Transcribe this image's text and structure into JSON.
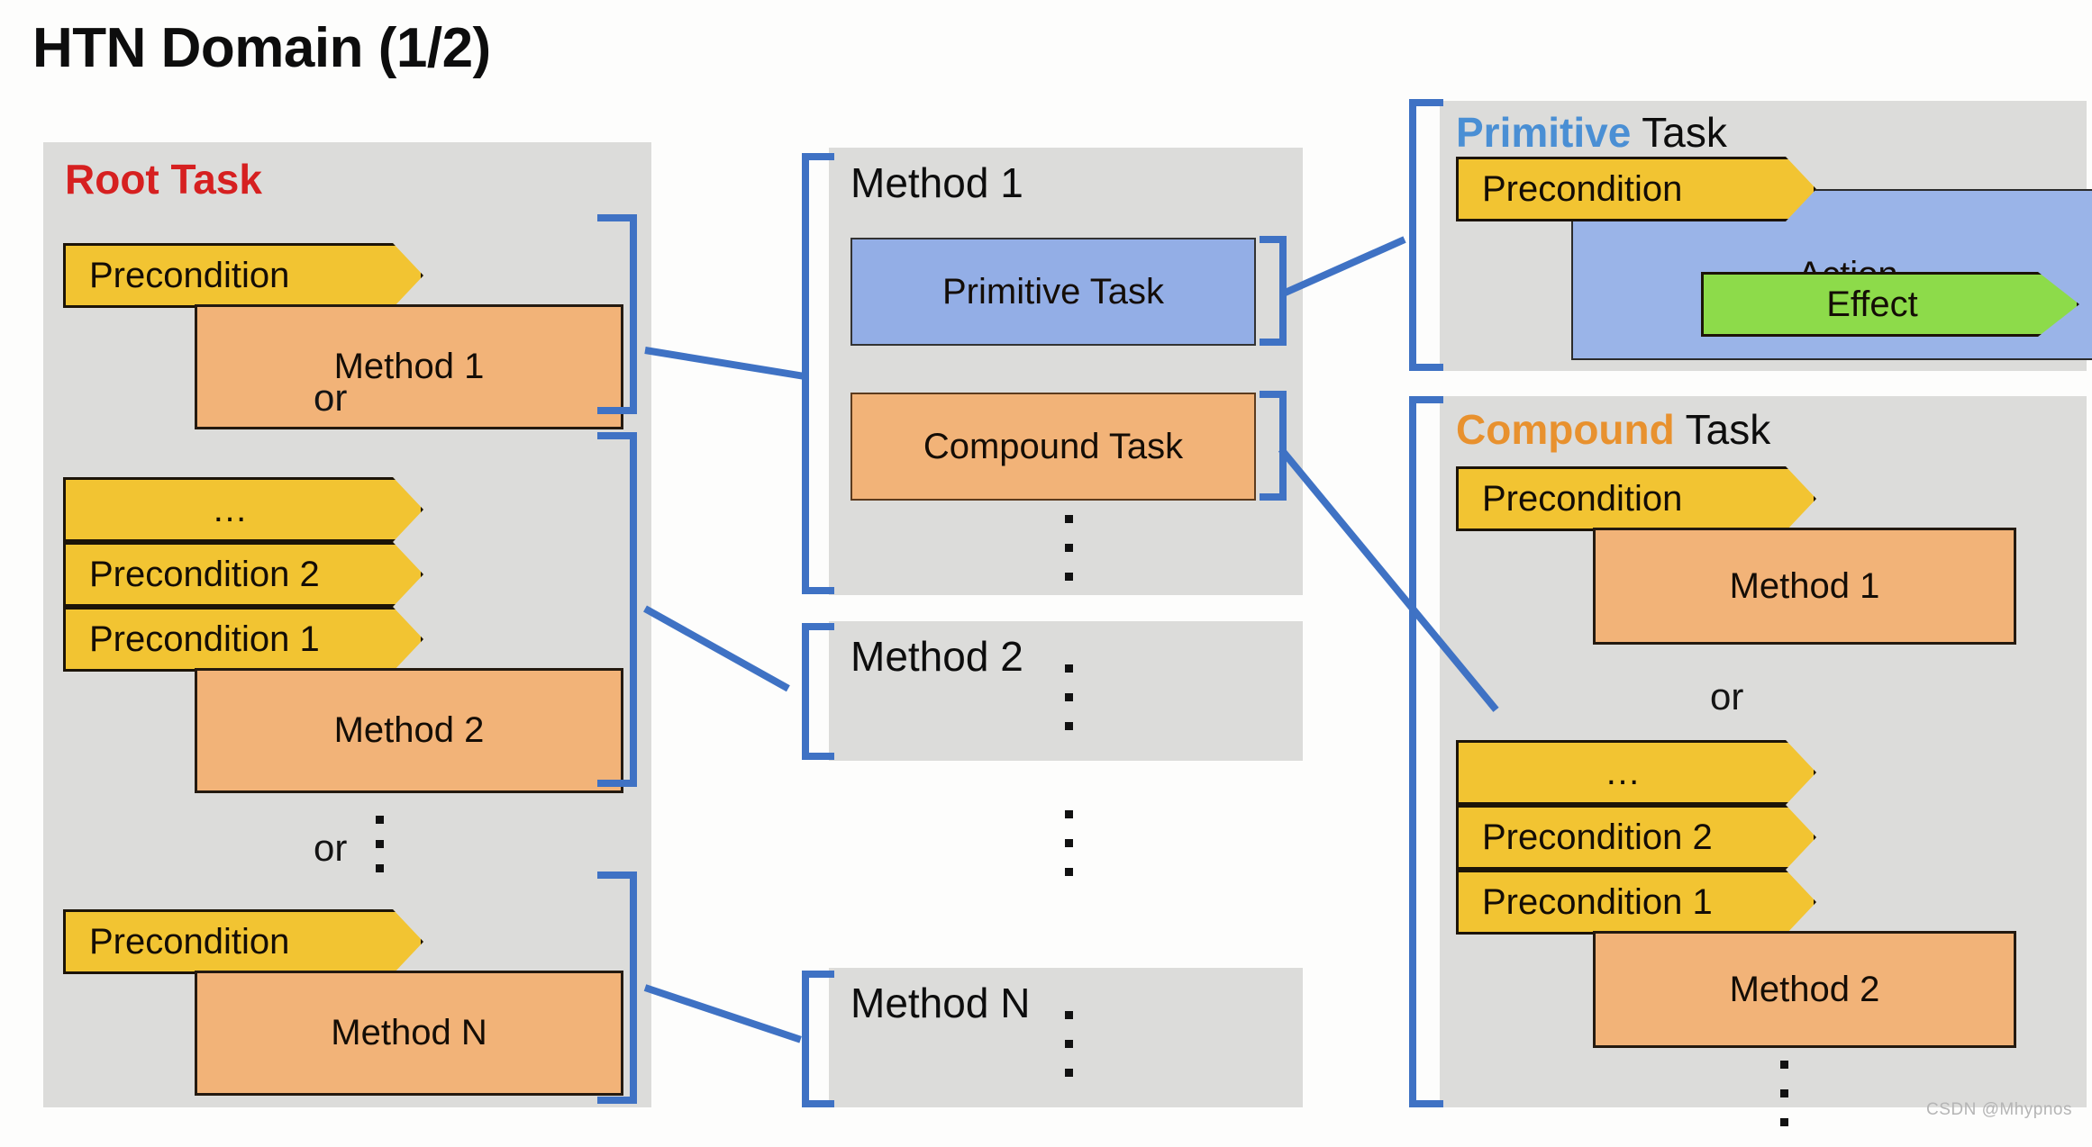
{
  "slide": {
    "title": "HTN Domain (1/2)",
    "watermark": "CSDN @Mhypnos"
  },
  "colors": {
    "panel_bg": "#dcdcda",
    "precondition": "#f2c432",
    "method": "#f2b378",
    "primitive": "#93aee6",
    "action": "#9ab4e8",
    "effect": "#8ddb4a",
    "connector": "#3f72c4",
    "root_task_title": "#d62020",
    "primitive_title": "#4a8fd4",
    "compound_title": "#e8912e",
    "title_text": "#0d0d0d"
  },
  "root_panel": {
    "heading": "Root Task",
    "or_1": "or",
    "or_2": "or",
    "alternatives": [
      {
        "preconditions": [
          "Precondition"
        ],
        "method": "Method 1"
      },
      {
        "preconditions": [
          "…",
          "Precondition 2",
          "Precondition 1"
        ],
        "method": "Method 2"
      },
      {
        "preconditions": [
          "Precondition"
        ],
        "method": "Method N"
      }
    ]
  },
  "methods_column": {
    "method_1": {
      "heading": "Method 1",
      "subtasks": [
        {
          "label": "Primitive Task",
          "kind": "primitive"
        },
        {
          "label": "Compound Task",
          "kind": "compound"
        }
      ]
    },
    "method_2": {
      "heading": "Method 2"
    },
    "method_n": {
      "heading": "Method N"
    }
  },
  "primitive_panel": {
    "heading_accent": "Primitive",
    "heading_rest": " Task",
    "precondition": "Precondition",
    "action": "Action",
    "effect": "Effect"
  },
  "compound_panel": {
    "heading_accent": "Compound",
    "heading_rest": " Task",
    "or": "or",
    "alternatives": [
      {
        "preconditions": [
          "Precondition"
        ],
        "method": "Method 1"
      },
      {
        "preconditions": [
          "…",
          "Precondition 2",
          "Precondition 1"
        ],
        "method": "Method 2"
      }
    ]
  }
}
